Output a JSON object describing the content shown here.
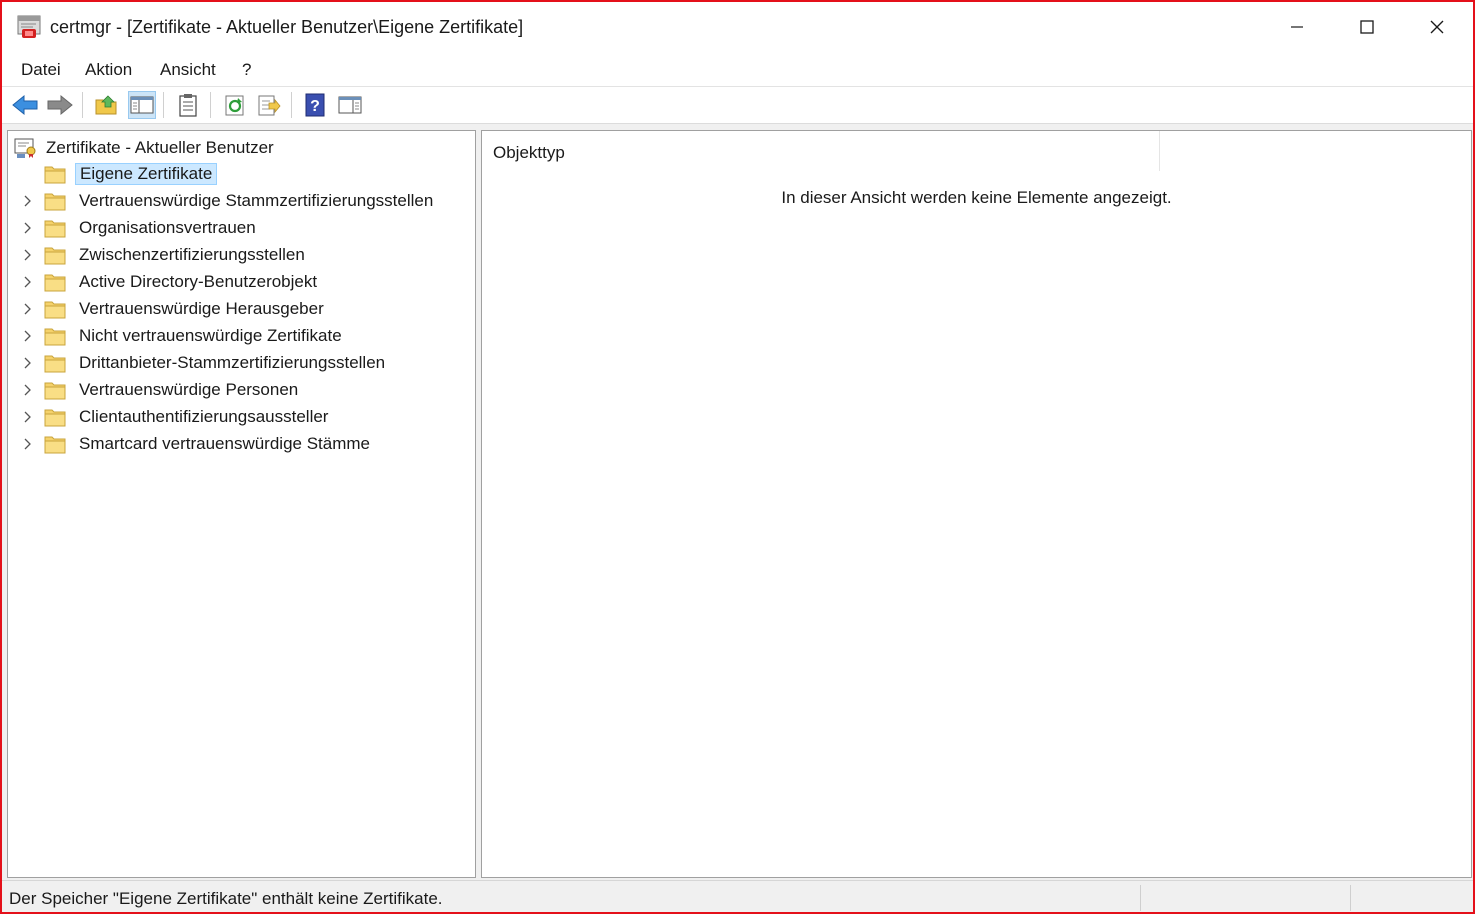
{
  "window": {
    "title": "certmgr - [Zertifikate - Aktueller Benutzer\\Eigene Zertifikate]",
    "controls": {
      "minimize": "minimize-icon",
      "maximize": "maximize-icon",
      "close": "close-icon"
    }
  },
  "menu": {
    "items": [
      {
        "label": "Datei"
      },
      {
        "label": "Aktion"
      },
      {
        "label": "Ansicht"
      },
      {
        "label": "?"
      }
    ]
  },
  "toolbar": {
    "buttons": [
      {
        "icon": "back-arrow-icon"
      },
      {
        "icon": "forward-arrow-icon"
      },
      {
        "icon": "up-folder-icon"
      },
      {
        "icon": "show-hide-console-tree-icon",
        "pressed": true
      },
      {
        "icon": "clipboard-icon"
      },
      {
        "icon": "refresh-icon"
      },
      {
        "icon": "export-list-icon"
      },
      {
        "icon": "help-icon"
      },
      {
        "icon": "show-hide-action-pane-icon"
      }
    ]
  },
  "tree": {
    "root": {
      "label": "Zertifikate - Aktueller Benutzer",
      "icon": "certificate-store-icon"
    },
    "nodes": [
      {
        "label": "Eigene Zertifikate",
        "selected": true,
        "expandable": false
      },
      {
        "label": "Vertrauenswürdige Stammzertifizierungsstellen",
        "expandable": true
      },
      {
        "label": "Organisationsvertrauen",
        "expandable": true
      },
      {
        "label": "Zwischenzertifizierungsstellen",
        "expandable": true
      },
      {
        "label": "Active Directory-Benutzerobjekt",
        "expandable": true
      },
      {
        "label": "Vertrauenswürdige Herausgeber",
        "expandable": true
      },
      {
        "label": "Nicht vertrauenswürdige Zertifikate",
        "expandable": true
      },
      {
        "label": "Drittanbieter-Stammzertifizierungsstellen",
        "expandable": true
      },
      {
        "label": "Vertrauenswürdige Personen",
        "expandable": true
      },
      {
        "label": "Clientauthentifizierungsaussteller",
        "expandable": true
      },
      {
        "label": "Smartcard vertrauenswürdige Stämme",
        "expandable": true
      }
    ]
  },
  "list": {
    "column_header": "Objekttyp",
    "empty_message": "In dieser Ansicht werden keine Elemente angezeigt."
  },
  "status": {
    "text": "Der Speicher \"Eigene Zertifikate\" enthält keine Zertifikate."
  },
  "colors": {
    "window_border": "#e4101a",
    "selection_bg": "#cce8ff",
    "selection_border": "#99d1ff",
    "folder": "#f5d26b"
  }
}
